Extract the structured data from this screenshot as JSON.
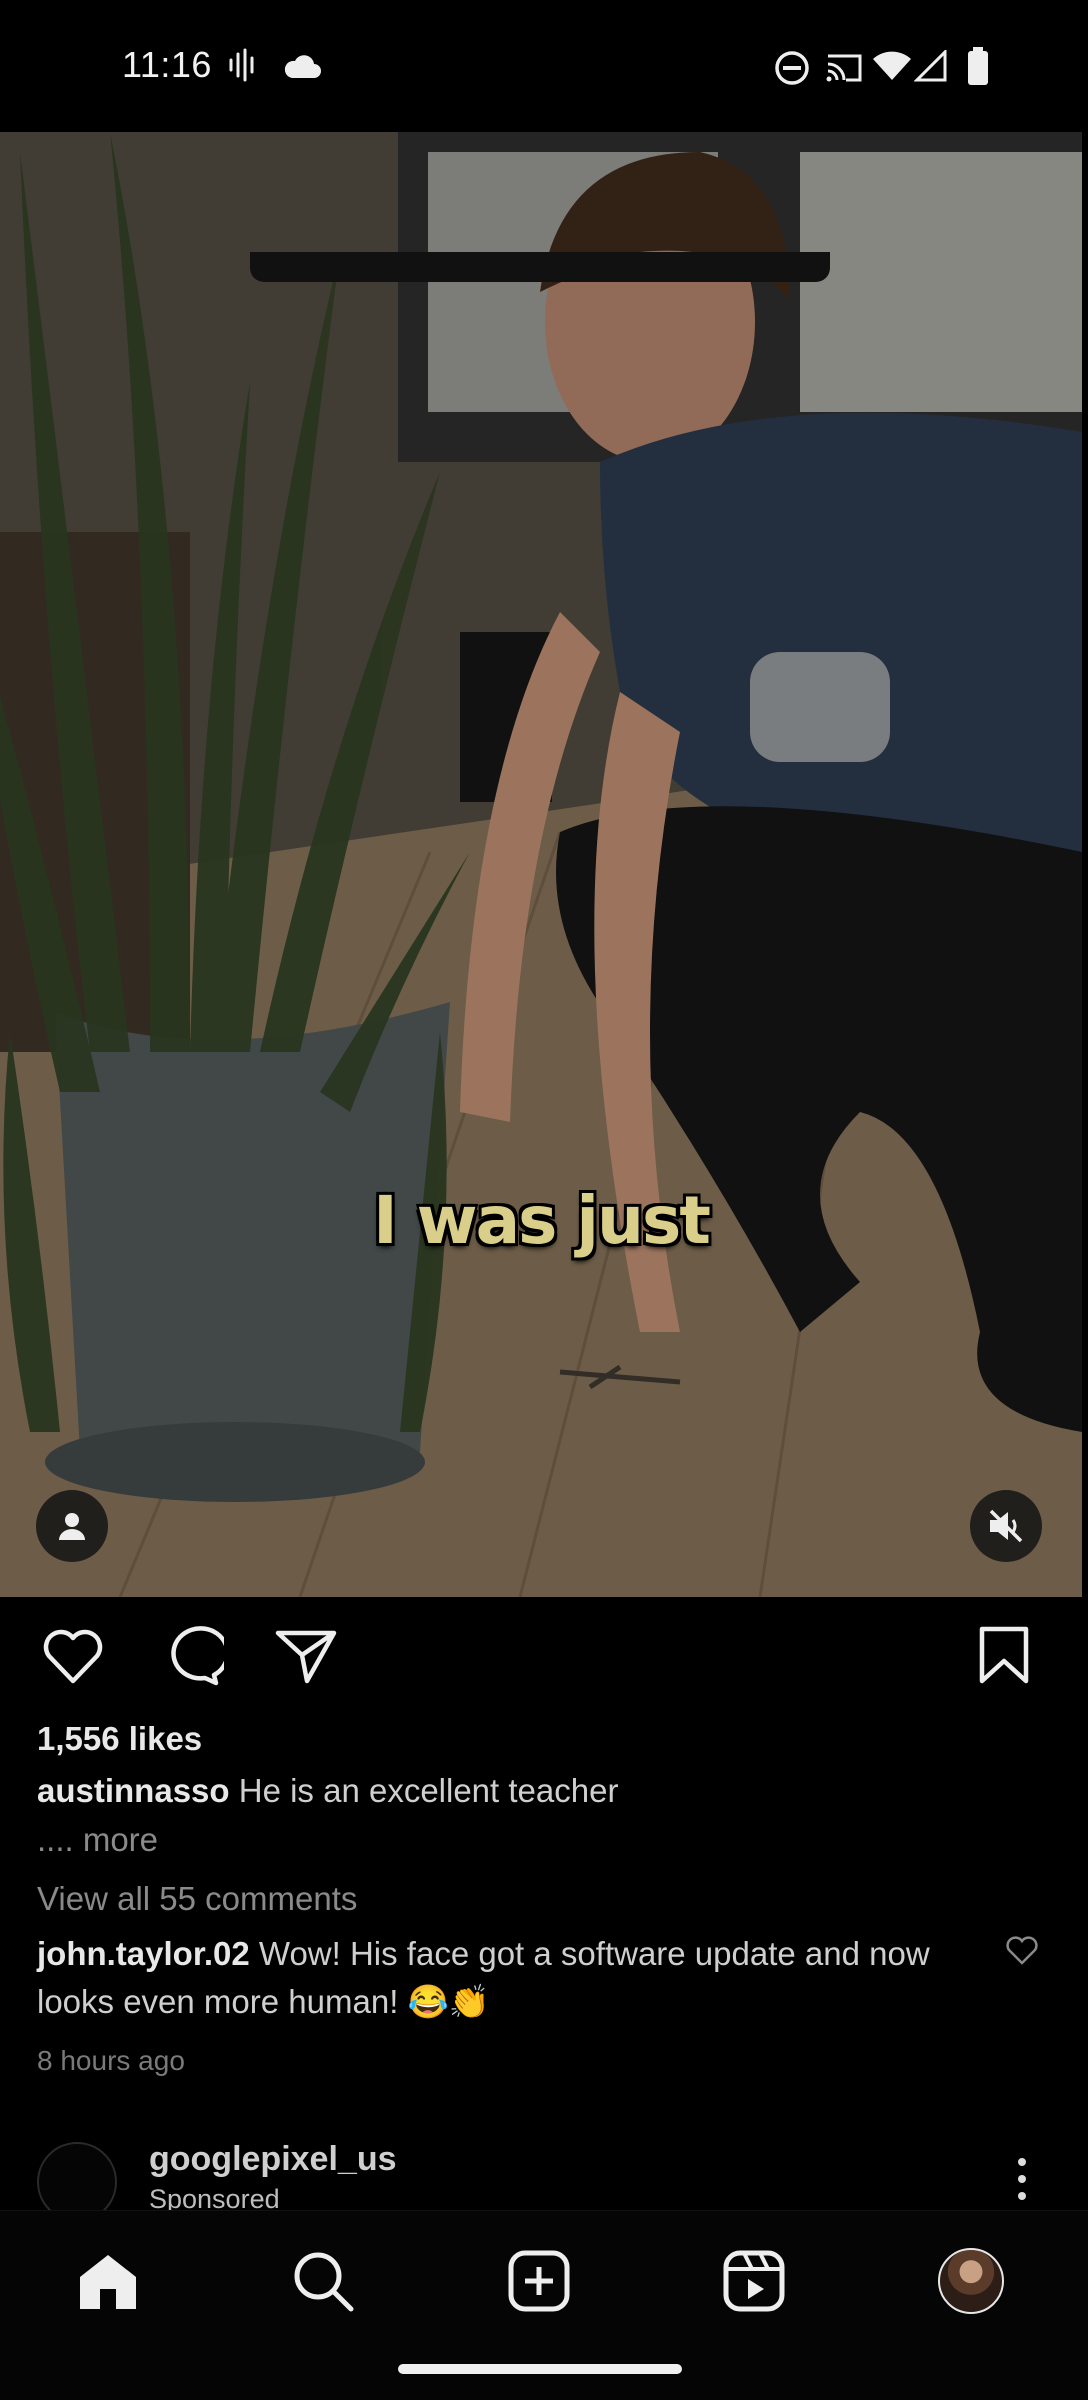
{
  "status_bar": {
    "time": "11:16",
    "icons": [
      "voice-icon",
      "cloud-icon",
      "do-not-disturb-icon",
      "cast-icon",
      "wifi-icon",
      "signal-icon",
      "battery-icon"
    ]
  },
  "post": {
    "video_caption": "I was just",
    "likes": "1,556 likes",
    "author": "austinnasso",
    "caption": "He is an excellent teacher",
    "more": ".... more",
    "view_all_comments": "View all 55 comments",
    "comment": {
      "user": "john.taylor.02",
      "text": "Wow! His face got a software update and now looks even more human! 😂👏"
    },
    "time_ago": "8 hours ago"
  },
  "next_post": {
    "username": "googlepixel_us",
    "subtitle": "Sponsored"
  },
  "bottom_nav": [
    "home-icon",
    "search-icon",
    "create-icon",
    "reels-icon",
    "profile-icon"
  ],
  "colors": {
    "background": "#000000",
    "text": "#f5f5f5",
    "muted": "#8a8a8a"
  }
}
